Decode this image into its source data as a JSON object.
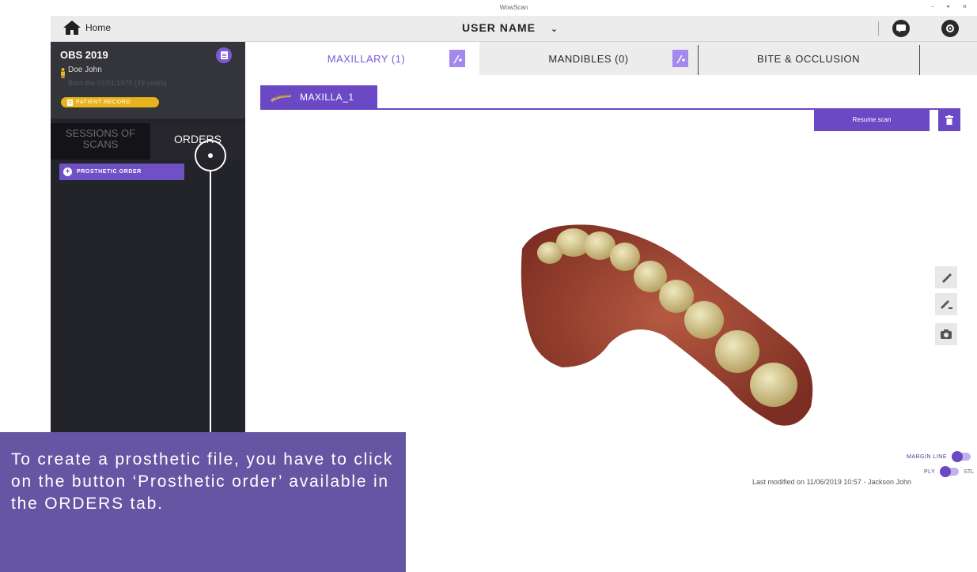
{
  "window": {
    "title": "WowScan",
    "controls": "- ▪ ×"
  },
  "topbar": {
    "home_label": "Home",
    "user_name": "USER NAME",
    "user_chevron": "⌄"
  },
  "patient": {
    "id": "OBS 2019",
    "name": "Doe John",
    "dob": "Born the 01/01/1970 (49 years)",
    "record_button": "PATIENT RECORD"
  },
  "sidebar_tabs": {
    "sessions": "SESSIONS OF SCANS",
    "orders": "ORDERS"
  },
  "orders": {
    "prosthetic_button": "PROSTHETIC ORDER"
  },
  "jaw_tabs": [
    {
      "label": "MAXILLARY (1)"
    },
    {
      "label": "MANDIBLES (0)"
    },
    {
      "label": "BITE & OCCLUSION"
    }
  ],
  "scan": {
    "tab_label": "MAXILLA_1",
    "resume_button": "Resume scan",
    "last_modified": "Last modified on 11/06/2019 10:57 - Jackson John"
  },
  "toggles": {
    "margin_line": "MARGIN LINE",
    "ply": "PLY",
    "stl": "STL"
  },
  "callout": {
    "text": "To create a prosthetic file, you have to click on the button ‘Prosthetic order’ available in the ORDERS tab."
  },
  "colors": {
    "accent": "#6b49c5",
    "record": "#e9b31d",
    "callout": "#6655a3",
    "sidebar": "#23232a"
  },
  "icons": [
    "home-icon",
    "chat-icon",
    "settings-icon",
    "document-icon",
    "person-icon",
    "plus-icon",
    "trash-icon",
    "pencil-icon",
    "pencil-auto-icon",
    "camera-icon",
    "scan-thumbnail-icon",
    "add-tooth-icon"
  ]
}
